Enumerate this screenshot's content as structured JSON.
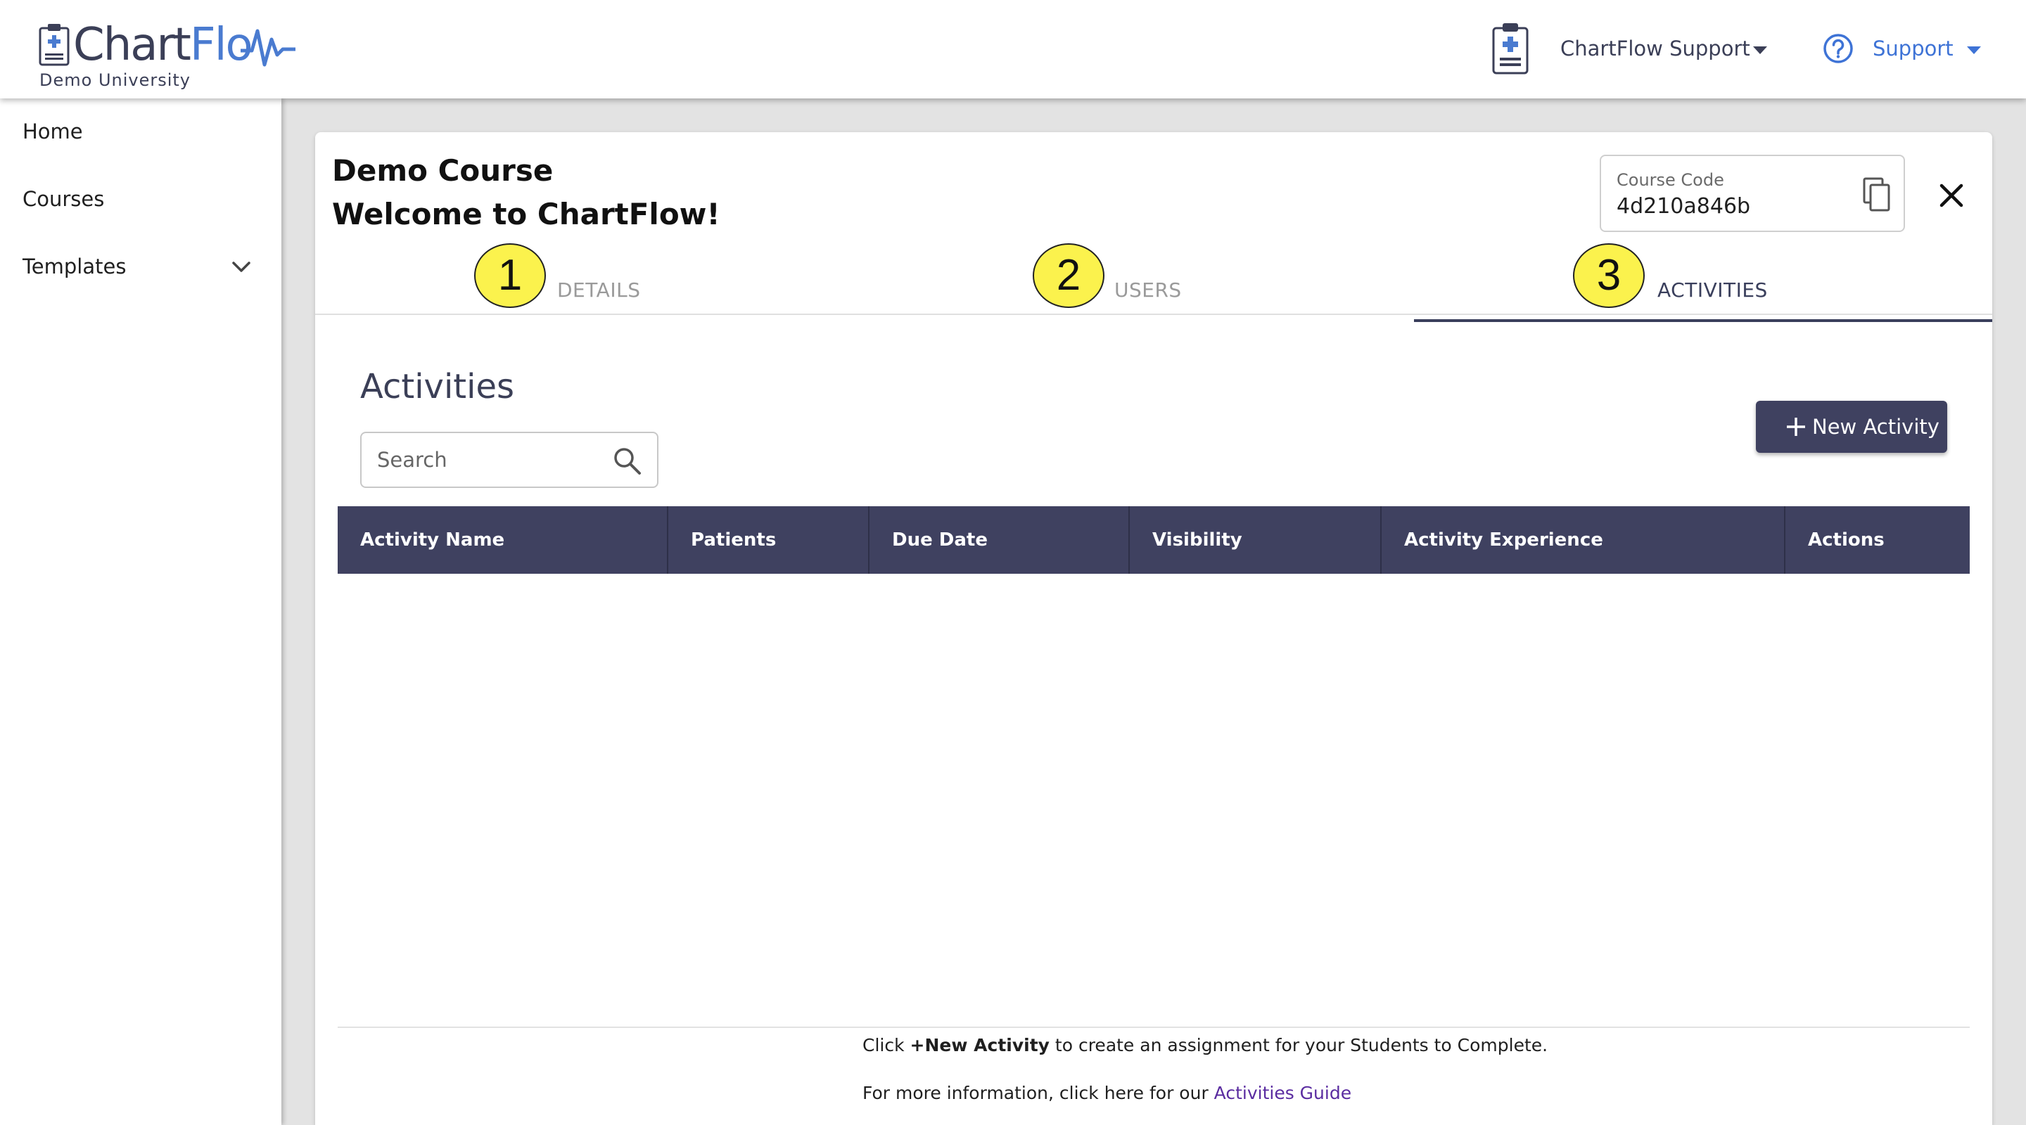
{
  "header": {
    "logo_text_part1": "Chart",
    "logo_text_part2": "Flo",
    "logo_subtitle": "Demo University",
    "account_name": "ChartFlow Support",
    "support_label": "Support",
    "brand_color": "#4a7bd0",
    "support_color": "#3e73d6"
  },
  "sidebar": {
    "items": [
      {
        "label": "Home"
      },
      {
        "label": "Courses"
      },
      {
        "label": "Templates"
      }
    ]
  },
  "course": {
    "title": "Demo Course",
    "welcome": "Welcome to ChartFlow!",
    "code_label": "Course Code",
    "code_value": "4d210a846b"
  },
  "tabs": [
    {
      "badge": "1",
      "label": "DETAILS",
      "active": false
    },
    {
      "badge": "2",
      "label": "USERS",
      "active": false
    },
    {
      "badge": "3",
      "label": "ACTIVITIES",
      "active": true
    }
  ],
  "activities": {
    "heading": "Activities",
    "search_placeholder": "Search",
    "new_button_label": "New Activity",
    "columns": [
      "Activity Name",
      "Patients",
      "Due Date",
      "Visibility",
      "Activity Experience",
      "Actions"
    ],
    "rows": []
  },
  "footer": {
    "line1_prefix": "Click ",
    "line1_bold": "+New Activity",
    "line1_suffix": " to create an assignment for your Students to Complete.",
    "line2_prefix": "For more information, click here for our ",
    "line2_link": "Activities Guide"
  },
  "colors": {
    "accent": "#3f4160",
    "highlight_badge": "#fbf24d",
    "link": "#5a2ca0"
  }
}
